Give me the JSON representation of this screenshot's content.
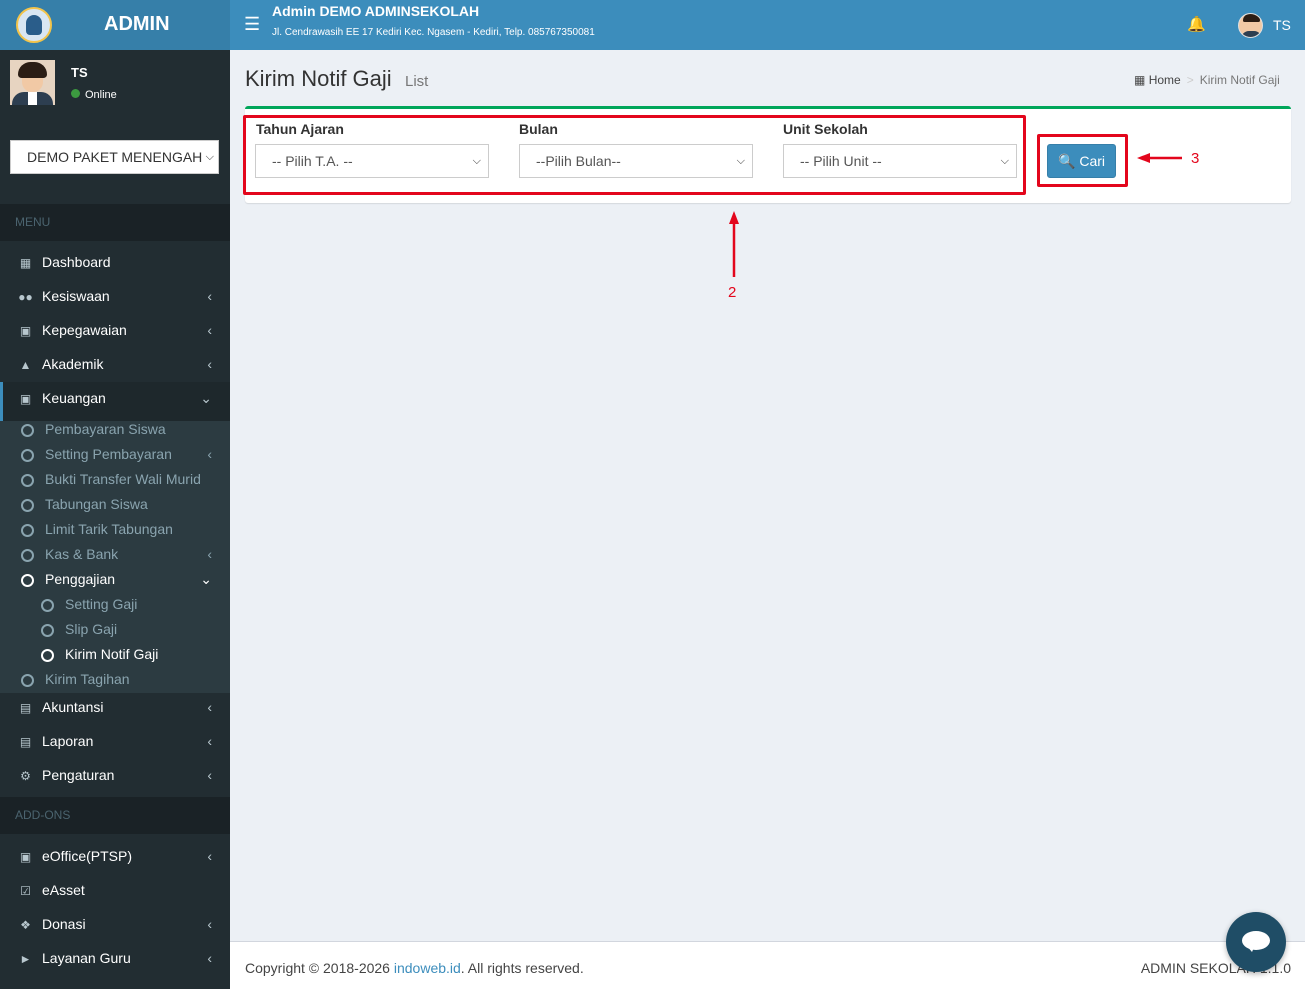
{
  "sidebar": {
    "logo_text": "ADMIN",
    "user": {
      "name": "TS",
      "status": "Online"
    },
    "school_select": "DEMO PAKET MENENGAH",
    "menu_header": "MENU",
    "addons_header": "ADD-ONS",
    "items": [
      {
        "label": "Dashboard",
        "icon": "grid-icon"
      },
      {
        "label": "Kesiswaan",
        "icon": "users-icon"
      },
      {
        "label": "Kepegawaian",
        "icon": "briefcase-icon"
      },
      {
        "label": "Akademik",
        "icon": "graduation-cap-icon"
      },
      {
        "label": "Keuangan",
        "icon": "money-icon"
      },
      {
        "label": "Akuntansi",
        "icon": "credit-card-icon"
      },
      {
        "label": "Laporan",
        "icon": "file-text-icon"
      },
      {
        "label": "Pengaturan",
        "icon": "gear-icon"
      }
    ],
    "keuangan_sub": [
      "Pembayaran Siswa",
      "Setting Pembayaran",
      "Bukti Transfer Wali Murid",
      "Tabungan Siswa",
      "Limit Tarik Tabungan",
      "Kas & Bank",
      "Penggajian",
      "Kirim Tagihan"
    ],
    "penggajian_sub": [
      "Setting Gaji",
      "Slip Gaji",
      "Kirim Notif Gaji"
    ],
    "addons": [
      {
        "label": "eOffice(PTSP)",
        "icon": "archive-icon"
      },
      {
        "label": "eAsset",
        "icon": "check-square-icon"
      },
      {
        "label": "Donasi",
        "icon": "dropbox-icon"
      },
      {
        "label": "Layanan Guru",
        "icon": "bullhorn-icon"
      }
    ]
  },
  "navbar": {
    "title": "Admin DEMO ADMINSEKOLAH",
    "address": "Jl. Cendrawasih EE 17 Kediri Kec. Ngasem - Kediri, Telp. 085767350081",
    "user": "TS"
  },
  "page": {
    "title": "Kirim Notif Gaji",
    "subtitle": "List",
    "breadcrumb": {
      "home": "Home",
      "current": "Kirim Notif Gaji"
    }
  },
  "form": {
    "tahun": {
      "label": "Tahun Ajaran",
      "value": "-- Pilih T.A. --"
    },
    "bulan": {
      "label": "Bulan",
      "value": "--Pilih Bulan--"
    },
    "unit": {
      "label": "Unit Sekolah",
      "value": "-- Pilih Unit --"
    },
    "search_button": "Cari"
  },
  "annotations": {
    "label_2": "2",
    "label_3": "3",
    "color": "#e3061c"
  },
  "footer": {
    "copy_prefix": "Copyright © 2018-2026 ",
    "link": "indoweb.id",
    "copy_suffix": ". All rights reserved.",
    "version": "ADMIN SEKOLAH 1.1.0"
  },
  "colors": {
    "primary": "#3c8dbc",
    "sidebar": "#222d32",
    "box_top": "#00a65a"
  }
}
